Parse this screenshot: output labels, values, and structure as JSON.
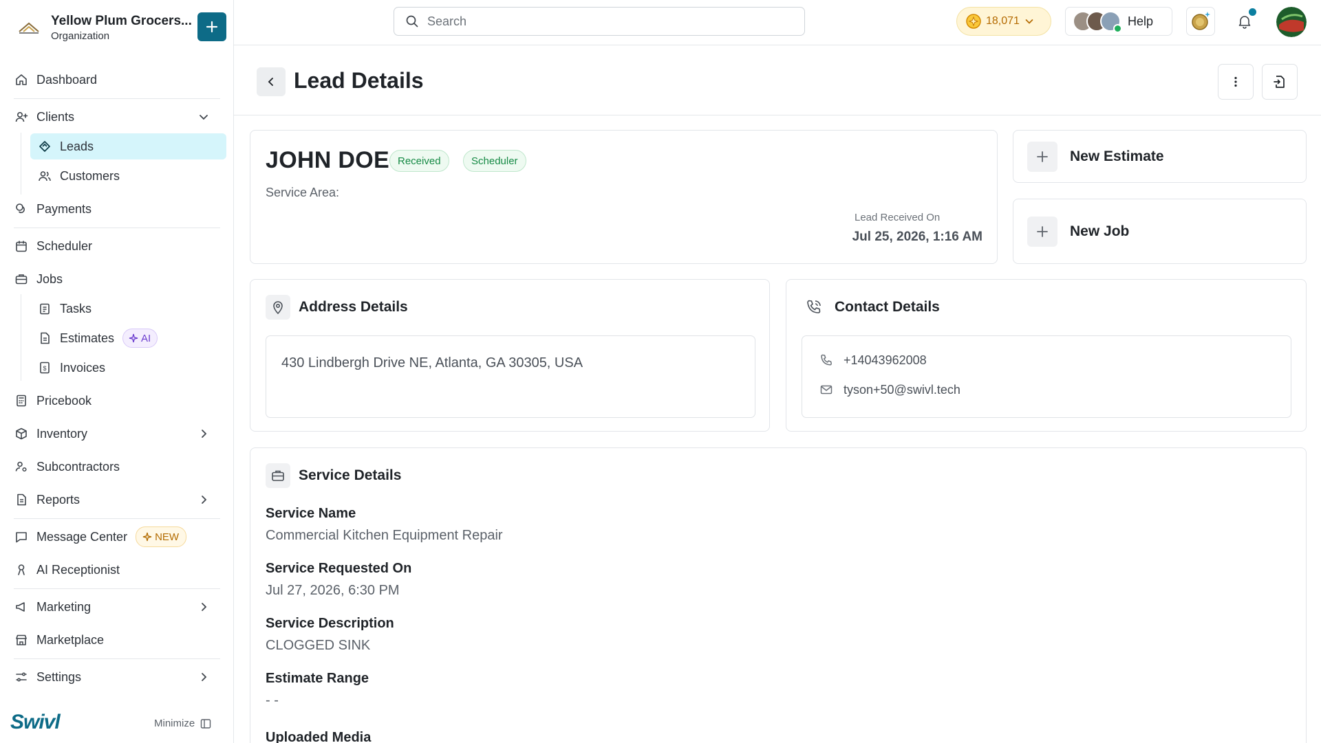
{
  "org": {
    "name": "Yellow Plum Grocers...",
    "type": "Organization"
  },
  "sidebar": {
    "items": [
      {
        "label": "Dashboard"
      },
      {
        "label": "Clients"
      },
      {
        "label": "Leads"
      },
      {
        "label": "Customers"
      },
      {
        "label": "Payments"
      },
      {
        "label": "Scheduler"
      },
      {
        "label": "Jobs"
      },
      {
        "label": "Tasks"
      },
      {
        "label": "Estimates",
        "badge": "AI"
      },
      {
        "label": "Invoices"
      },
      {
        "label": "Pricebook"
      },
      {
        "label": "Inventory"
      },
      {
        "label": "Subcontractors"
      },
      {
        "label": "Reports"
      },
      {
        "label": "Message Center",
        "badge": "NEW"
      },
      {
        "label": "AI Receptionist"
      },
      {
        "label": "Marketing"
      },
      {
        "label": "Marketplace"
      },
      {
        "label": "Settings"
      }
    ],
    "active": "Leads",
    "brand": "Swivl",
    "minimize_label": "Minimize"
  },
  "topbar": {
    "search_placeholder": "Search",
    "coins": "18,071",
    "help_label": "Help"
  },
  "header": {
    "title": "Lead Details"
  },
  "lead": {
    "name": "JOHN DOE",
    "status_tags": [
      "Received",
      "Scheduler"
    ],
    "service_area_label": "Service Area:",
    "received_label": "Lead Received On",
    "received_value": "Jul 25, 2026, 1:16 AM"
  },
  "actions": {
    "new_estimate": "New Estimate",
    "new_job": "New Job"
  },
  "address": {
    "title": "Address Details",
    "value": "430 Lindbergh Drive NE, Atlanta, GA 30305, USA"
  },
  "contact": {
    "title": "Contact Details",
    "phone": "+14043962008",
    "email": "tyson+50@swivl.tech"
  },
  "service": {
    "title": "Service Details",
    "fields": [
      {
        "label": "Service Name",
        "value": "Commercial Kitchen Equipment Repair"
      },
      {
        "label": "Service Requested On",
        "value": "Jul 27, 2026, 6:30 PM"
      },
      {
        "label": "Service Description",
        "value": "CLOGGED SINK"
      },
      {
        "label": "Estimate Range",
        "value": "- -"
      },
      {
        "label": "Uploaded Media",
        "value": ""
      }
    ]
  },
  "colors": {
    "brand": "#0d6b87",
    "active_nav_bg": "#d5f5fb",
    "tag_green": "#168a45"
  }
}
